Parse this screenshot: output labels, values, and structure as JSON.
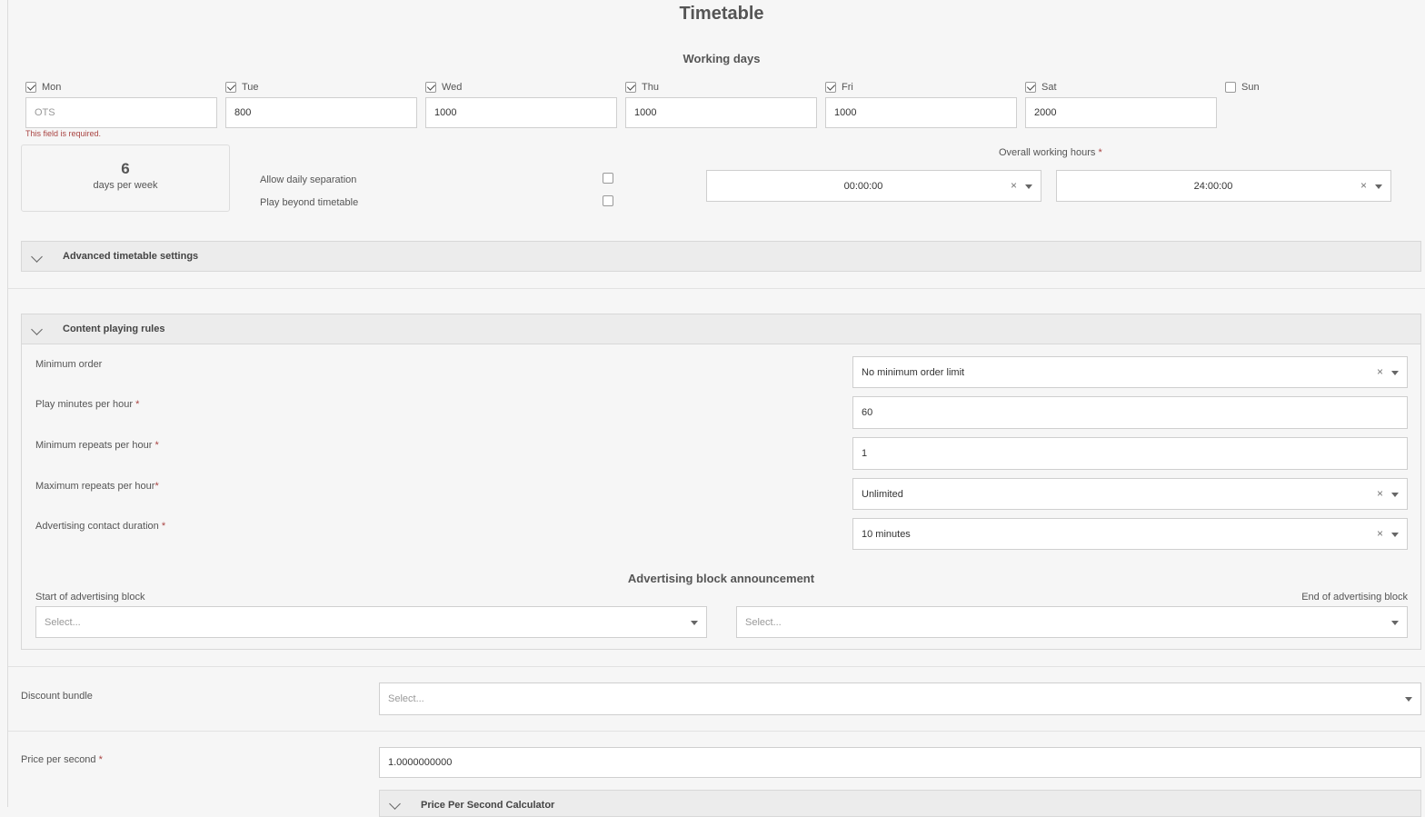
{
  "title": "Timetable",
  "working_days": {
    "heading": "Working days",
    "days": [
      {
        "label": "Mon",
        "checked": true,
        "value": "",
        "placeholder": "OTS"
      },
      {
        "label": "Tue",
        "checked": true,
        "value": "800"
      },
      {
        "label": "Wed",
        "checked": true,
        "value": "1000"
      },
      {
        "label": "Thu",
        "checked": true,
        "value": "1000"
      },
      {
        "label": "Fri",
        "checked": true,
        "value": "1000"
      },
      {
        "label": "Sat",
        "checked": true,
        "value": "2000"
      },
      {
        "label": "Sun",
        "checked": false
      }
    ],
    "error": "This field is required."
  },
  "summary": {
    "count": "6",
    "label": "days per week"
  },
  "options": {
    "allow_daily_separation": "Allow daily separation",
    "play_beyond_timetable": "Play beyond timetable"
  },
  "overall_hours": {
    "label": "Overall working hours",
    "required_mark": "*",
    "start": "00:00:00",
    "end": "24:00:00"
  },
  "advanced": {
    "title": "Advanced timetable settings"
  },
  "content_rules": {
    "title": "Content playing rules",
    "minimum_order": {
      "label": "Minimum order",
      "value": "No minimum order limit"
    },
    "play_minutes": {
      "label": "Play minutes per hour",
      "req": "*",
      "value": "60"
    },
    "min_repeats": {
      "label": "Minimum repeats per hour",
      "req": "*",
      "value": "1"
    },
    "max_repeats": {
      "label": "Maximum repeats per hour",
      "req": "*",
      "value": "Unlimited"
    },
    "contact_duration": {
      "label": "Advertising contact duration",
      "req": "*",
      "value": "10 minutes"
    },
    "announcement": {
      "heading": "Advertising block announcement",
      "start_label": "Start of advertising block",
      "end_label": "End of advertising block",
      "start_placeholder": "Select...",
      "end_placeholder": "Select..."
    }
  },
  "discount_bundle": {
    "label": "Discount bundle",
    "placeholder": "Select..."
  },
  "price_per_second": {
    "label": "Price per second",
    "req": "*",
    "value": "1.0000000000"
  },
  "calculator": {
    "title": "Price Per Second Calculator"
  },
  "icons": {
    "clear": "×"
  }
}
